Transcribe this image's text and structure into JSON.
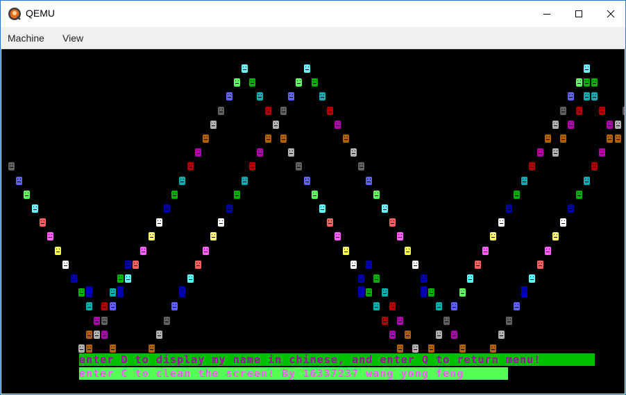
{
  "window": {
    "title": "QEMU",
    "menu": [
      "Machine",
      "View"
    ]
  },
  "screen": {
    "line1": "enter D to display my name in chinese, and enter Q to return menu!",
    "line2": "enter C to clean the screen! By 16337237 wang yong feng",
    "line1_colors": {
      "bg": "#00c000",
      "fg": "#b000b0"
    },
    "line2_colors": {
      "bg": "#55ff55",
      "fg": "#ff55ff"
    }
  },
  "palette": [
    "#0000b0",
    "#00b000",
    "#00b0b0",
    "#b00000",
    "#b000b0",
    "#b06000",
    "#b0b0b0",
    "#606060",
    "#6060ff",
    "#60ff60",
    "#60ffff",
    "#ff6060",
    "#ff60ff",
    "#ffff60",
    "#ffffff"
  ]
}
